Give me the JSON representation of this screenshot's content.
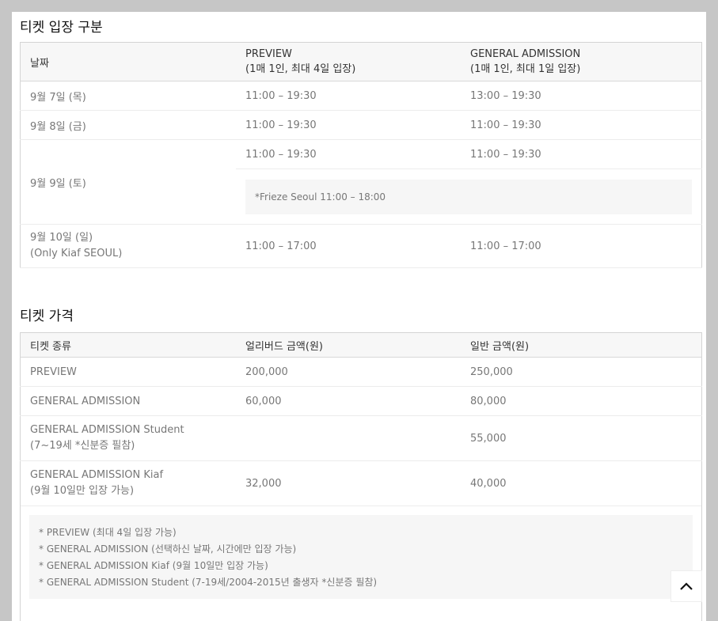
{
  "entry": {
    "title": "티켓 입장 구분",
    "headers": {
      "date": "날짜",
      "preview_line1": "PREVIEW",
      "preview_line2": "(1매 1인, 최대 4일 입장)",
      "general_line1": "GENERAL ADMISSION",
      "general_line2": "(1매 1인, 최대 1일 입장)"
    },
    "rows": [
      {
        "date": "9월 7일 (목)",
        "preview": "11:00 – 19:30",
        "general": "13:00 – 19:30"
      },
      {
        "date": "9월 8일 (금)",
        "preview": "11:00 – 19:30",
        "general": "11:00 – 19:30"
      },
      {
        "date": "9월 9일 (토)",
        "preview": "11:00 – 19:30",
        "general": "11:00 – 19:30",
        "note": "*Frieze Seoul 11:00 – 18:00"
      },
      {
        "date": "9월 10일 (일)",
        "date_sub": "(Only Kiaf SEOUL)",
        "preview": "11:00 – 17:00",
        "general": "11:00 – 17:00"
      }
    ]
  },
  "price": {
    "title": "티켓 가격",
    "headers": {
      "type": "티켓 종류",
      "early": "얼리버드 금액(원)",
      "regular": "일반 금액(원)"
    },
    "rows": [
      {
        "type": "PREVIEW",
        "early": "200,000",
        "regular": "250,000"
      },
      {
        "type": "GENERAL ADMISSION",
        "early": "60,000",
        "regular": "80,000"
      },
      {
        "type": "GENERAL ADMISSION Student",
        "type_sub": "(7~19세 *신분증 필참)",
        "early": "",
        "regular": "55,000"
      },
      {
        "type": "GENERAL ADMISSION Kiaf",
        "type_sub": "(9월 10일만 입장 가능)",
        "early": "32,000",
        "regular": "40,000"
      }
    ],
    "notes": [
      "* PREVIEW (최대 4일 입장 가능)",
      "* GENERAL ADMISSION (선택하신 날짜, 시간에만 입장 가능)",
      "* GENERAL ADMISSION Kiaf (9월 10일만 입장 가능)",
      "* GENERAL ADMISSION Student (7-19세/2004-2015년 출생자 *신분증 필참)"
    ]
  },
  "scroll_top_icon": "chevron-up-icon"
}
